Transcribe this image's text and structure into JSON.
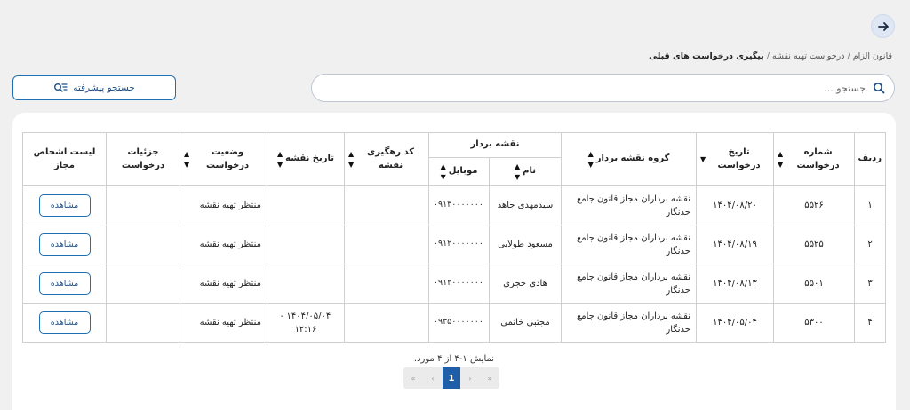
{
  "nav": {
    "back_icon": "arrow-right-icon"
  },
  "breadcrumb": {
    "items": [
      "قانون الزام",
      "درخواست تهیه نقشه"
    ],
    "separator": "/",
    "current": "پیگیری درخواست های قبلی"
  },
  "search": {
    "placeholder": "جستجو ...",
    "value": ""
  },
  "advanced_search": {
    "label": "جستجو پیشرفته"
  },
  "table": {
    "headers": {
      "row": "ردیف",
      "request_number": "شماره درخواست",
      "request_date": "تاریخ درخواست",
      "surveyor_group": "گروه نقشه بردار",
      "surveyor": "نقشه بردار",
      "name": "نام",
      "mobile": "موبایل",
      "tracking_code": "کد رهگیری نقشه",
      "map_date": "تاریخ نقشه",
      "status": "وضعیت درخواست",
      "details": "جزئیات درخواست",
      "allowed_persons": "لیست اشخاص مجاز"
    },
    "rows": [
      {
        "row": "۱",
        "request_number": "۵۵۲۶",
        "request_date": "۱۴۰۴/۰۸/۲۰",
        "surveyor_group": "نقشه برداران مجاز قانون جامع حدنگار",
        "name": "سیدمهدی جاهد",
        "mobile": "۰۹۱۳۰۰۰۰۰۰۰",
        "tracking_code": "",
        "map_date": "",
        "status": "منتظر تهیه نقشه",
        "details": "",
        "action": "مشاهده"
      },
      {
        "row": "۲",
        "request_number": "۵۵۲۵",
        "request_date": "۱۴۰۴/۰۸/۱۹",
        "surveyor_group": "نقشه برداران مجاز قانون جامع حدنگار",
        "name": "مسعود طولابی",
        "mobile": "۰۹۱۲۰۰۰۰۰۰۰",
        "tracking_code": "",
        "map_date": "",
        "status": "منتظر تهیه نقشه",
        "details": "",
        "action": "مشاهده"
      },
      {
        "row": "۳",
        "request_number": "۵۵۰۱",
        "request_date": "۱۴۰۴/۰۸/۱۳",
        "surveyor_group": "نقشه برداران مجاز قانون جامع حدنگار",
        "name": "هادی حجری",
        "mobile": "۰۹۱۲۰۰۰۰۰۰۰",
        "tracking_code": "",
        "map_date": "",
        "status": "منتظر تهیه نقشه",
        "details": "",
        "action": "مشاهده"
      },
      {
        "row": "۴",
        "request_number": "۵۳۰۰",
        "request_date": "۱۴۰۴/۰۵/۰۴",
        "surveyor_group": "نقشه برداران مجاز قانون جامع حدنگار",
        "name": "مجتبی خاتمی",
        "mobile": "۰۹۳۵۰۰۰۰۰۰۰",
        "tracking_code": "",
        "map_date": "۱۴۰۴/۰۵/۰۴ - ۱۲:۱۶",
        "status": "منتظر تهیه نقشه",
        "details": "",
        "action": "مشاهده"
      }
    ]
  },
  "footer": {
    "summary": "نمایش ۱-۴ از ۴ مورد.",
    "pager": {
      "first": "«",
      "prev": "‹",
      "current": "1",
      "next": "›",
      "last": "»"
    }
  },
  "colors": {
    "accent": "#1f6fb5",
    "active_page": "#1f5fa8",
    "background": "#f0f0f0"
  }
}
